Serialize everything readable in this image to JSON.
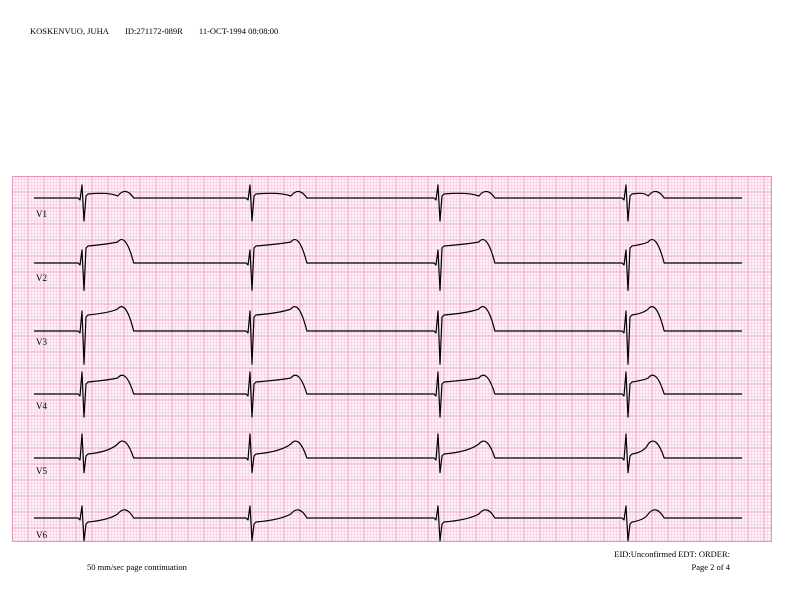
{
  "header": {
    "patient_name": "KOSKENVUO, JUHA",
    "patient_id": "ID:271172-089R",
    "datetime": "11-OCT-1994  08:08:00"
  },
  "leads": [
    {
      "label": "V1",
      "beats": 4
    },
    {
      "label": "V2",
      "beats": 4
    },
    {
      "label": "V3",
      "beats": 4
    },
    {
      "label": "V4",
      "beats": 4
    },
    {
      "label": "V5",
      "beats": 4
    },
    {
      "label": "V6",
      "beats": 4
    }
  ],
  "footer": {
    "speed": "50 mm/sec page continuation",
    "eid_line": "EID:Unconfirmed EDT:  ORDER:",
    "page": "Page 2 of 4"
  },
  "colors": {
    "grid_minor": "#f6c6de",
    "grid_major": "#ec8fbd",
    "grid_bg": "#fdf0f6",
    "trace": "#000000"
  }
}
